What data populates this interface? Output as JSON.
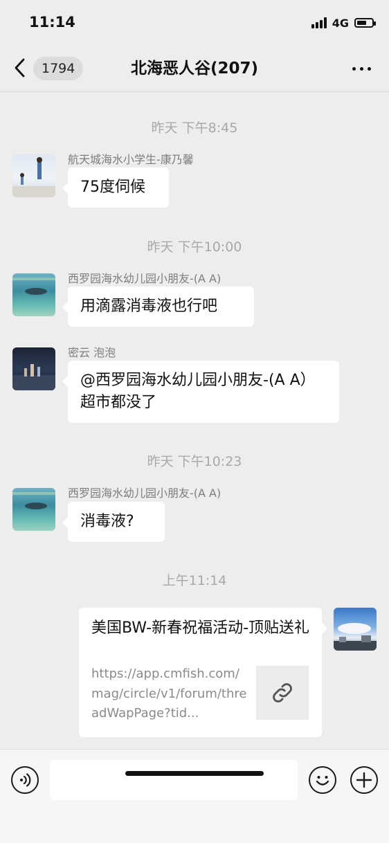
{
  "status_bar": {
    "time": "11:14",
    "network": "4G",
    "battery_level": 0.55,
    "signal_bars": 4
  },
  "nav": {
    "back_badge": "1794",
    "title": "北海恶人谷(207)"
  },
  "messages": [
    {
      "timestamp": "昨天 下午8:45"
    },
    {
      "sender": "航天城海水小学生-康乃馨",
      "text": "75度伺候"
    },
    {
      "timestamp": "昨天 下午10:00"
    },
    {
      "sender": "西罗园海水幼儿园小朋友-(A A)",
      "text": "用滴露消毒液也行吧"
    },
    {
      "sender": "密云 泡泡",
      "text": "@西罗园海水幼儿园小朋友-(A A） 超市都没了"
    },
    {
      "timestamp": "昨天 下午10:23"
    },
    {
      "sender": "西罗园海水幼儿园小朋友-(A A)",
      "text": "消毒液?"
    },
    {
      "timestamp": "上午11:14"
    },
    {
      "link_card": {
        "title": "美国BW-新春祝福活动-顶贴送礼",
        "url": "https://app.cmfish.com/mag/circle/v1/forum/threadWapPage?tid..."
      }
    }
  ],
  "input_bar": {
    "placeholder": ""
  },
  "colors": {
    "background": "#ededed",
    "bubble": "#ffffff",
    "timestamp": "#a8a8a8",
    "sender": "#7d7d7d"
  }
}
